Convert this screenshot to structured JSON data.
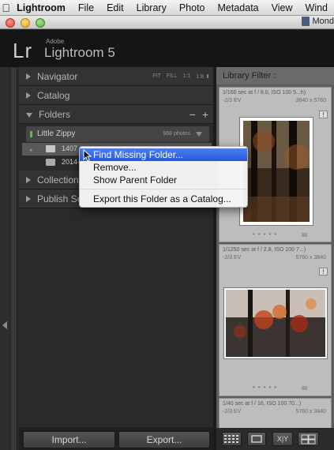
{
  "menubar": {
    "app": "Lightroom",
    "items": [
      "File",
      "Edit",
      "Library",
      "Photo",
      "Metadata",
      "View",
      "Wind"
    ]
  },
  "window": {
    "title": "Mond"
  },
  "identity": {
    "adobe": "Adobe",
    "logo": "Lr",
    "product": "Lightroom 5"
  },
  "left_panel": {
    "navigator": {
      "label": "Navigator",
      "options": [
        "FIT",
        "FILL",
        "1:1",
        "1:8 ⬍"
      ]
    },
    "catalog": {
      "label": "Catalog"
    },
    "folders": {
      "label": "Folders",
      "minus": "−",
      "plus": "+",
      "volume": {
        "name": "Little Zippy",
        "count": "968 photos"
      },
      "rows": [
        {
          "name": "1407"
        },
        {
          "name": "2014-"
        }
      ]
    },
    "collections": {
      "label": "Collection"
    },
    "publish": {
      "label": "Publish Se"
    }
  },
  "buttons": {
    "import": "Import...",
    "export": "Export..."
  },
  "library_filter": {
    "label": "Library Filter :"
  },
  "grid": {
    "cells": [
      {
        "meta1": "1/160 sec at f / 8.0, ISO 100    5...h)",
        "meta2": "-2/3 EV",
        "dims": "3840 x 5760",
        "flag": "!"
      },
      {
        "meta1": "1/1250 sec at f / 2.8, ISO 100    7...)",
        "meta2": "-2/3 EV",
        "dims": "5760 x 3840",
        "flag": "!"
      },
      {
        "meta1": "1/40 sec at f / 16, ISO 100     70...)",
        "meta2": "-2/3 EV",
        "dims": "5760 x 3840",
        "flag": ""
      }
    ]
  },
  "toolbar": {
    "compare_label": "X|Y"
  },
  "context_menu": {
    "items": [
      {
        "label": "Find Missing Folder...",
        "highlighted": true
      },
      {
        "label": "Remove..."
      },
      {
        "label": "Show Parent Folder"
      },
      {
        "label": "Export this Folder as a Catalog..."
      }
    ]
  },
  "colors": {
    "menu_highlight": "#2f63e6",
    "panel": "#2a2a2a",
    "grid_bg": "#5c5c5c",
    "cell": "#bdbdbd"
  }
}
